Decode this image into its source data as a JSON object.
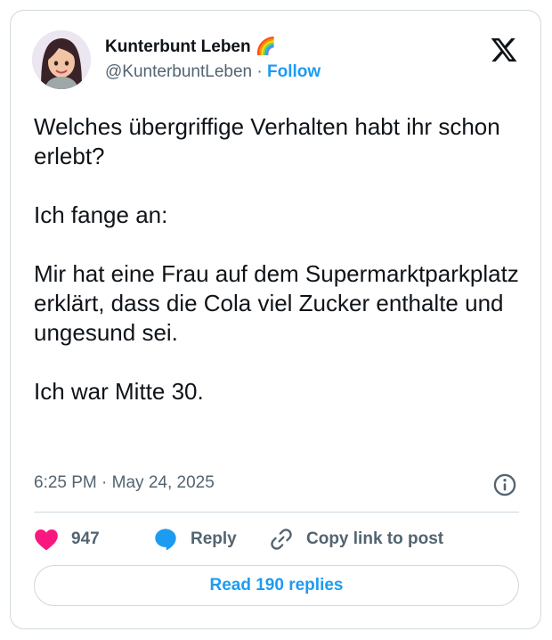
{
  "author": {
    "name": "Kunterbunt Leben 🌈",
    "handle": "@KunterbuntLeben",
    "separator": "·",
    "follow_label": "Follow"
  },
  "tweet": {
    "paragraphs": [
      "Welches übergriffige Verhalten habt ihr schon erlebt?",
      "Ich fange an:",
      "Mir hat eine Frau auf dem Supermarktparkplatz erklärt, dass die Cola viel Zucker enthalte und ungesund sei.",
      "Ich war Mitte 30."
    ],
    "timestamp": "6:25 PM · May 24, 2025"
  },
  "actions": {
    "like_count": "947",
    "reply_label": "Reply",
    "copy_link_label": "Copy link to post"
  },
  "read_replies_label": "Read 190 replies",
  "icons": {
    "avatar": "avatar",
    "logo": "x-logo-icon",
    "info": "info-icon",
    "like": "heart-icon",
    "reply": "speech-bubble-icon",
    "link": "link-icon"
  },
  "colors": {
    "accent": "#1d9bf0",
    "like": "#f91880",
    "text": "#0f1419",
    "secondary": "#536471",
    "border": "#cfd9de"
  }
}
